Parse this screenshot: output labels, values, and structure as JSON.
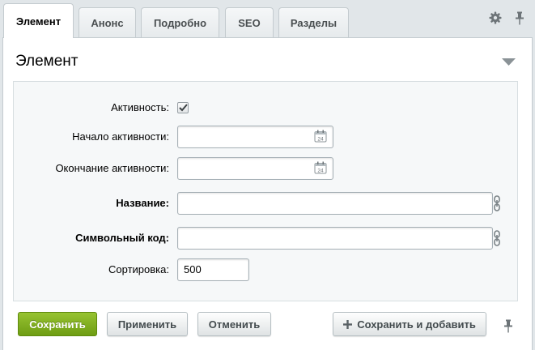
{
  "tabs": [
    {
      "label": "Элемент",
      "active": true
    },
    {
      "label": "Анонс",
      "active": false
    },
    {
      "label": "Подробно",
      "active": false
    },
    {
      "label": "SEO",
      "active": false
    },
    {
      "label": "Разделы",
      "active": false
    }
  ],
  "panel": {
    "title": "Элемент"
  },
  "form": {
    "active": {
      "label": "Активность:",
      "checked": true
    },
    "start": {
      "label": "Начало активности:",
      "value": ""
    },
    "end": {
      "label": "Окончание активности:",
      "value": ""
    },
    "name": {
      "label": "Название:",
      "value": ""
    },
    "code": {
      "label": "Символьный код:",
      "value": ""
    },
    "sort": {
      "label": "Сортировка:",
      "value": "500"
    },
    "calendar_day": "24"
  },
  "buttons": {
    "save": "Сохранить",
    "apply": "Применить",
    "cancel": "Отменить",
    "save_add": "Сохранить и добавить"
  },
  "colors": {
    "accent_green": "#7eaa1a",
    "background": "#e1e6e9",
    "panel": "#ffffff",
    "form_box": "#f6f8f9"
  },
  "icons": {
    "settings": "gear-icon",
    "pin": "pin-icon",
    "collapse": "triangle-down-icon",
    "calendar": "calendar-icon",
    "link": "chain-link-icon",
    "checkbox": "checkmark-icon",
    "plus": "plus-icon"
  }
}
